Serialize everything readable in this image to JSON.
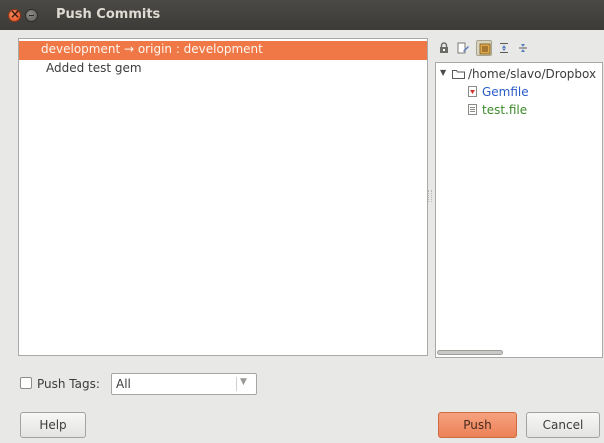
{
  "window": {
    "title": "Push Commits"
  },
  "commits": {
    "branch_row": "development → origin : development",
    "commit_row": "Added test gem"
  },
  "toolbar": {
    "icons": [
      "lock-icon",
      "edit-icon",
      "group-by-directory-icon",
      "expand-all-icon",
      "collapse-all-icon"
    ]
  },
  "tree": {
    "root": "/home/slavo/Dropbox",
    "files": [
      {
        "name": "Gemfile",
        "color": "#2a5cc7",
        "icon": "ruby-file-icon"
      },
      {
        "name": "test.file",
        "color": "#3c8a2a",
        "icon": "text-file-icon"
      }
    ]
  },
  "tags": {
    "checkbox_label": "Push Tags:",
    "checked": false,
    "selected": "All"
  },
  "buttons": {
    "help": "Help",
    "push": "Push",
    "cancel": "Cancel"
  },
  "colors": {
    "accent": "#f07746",
    "title_bar": "#3c3b37"
  }
}
